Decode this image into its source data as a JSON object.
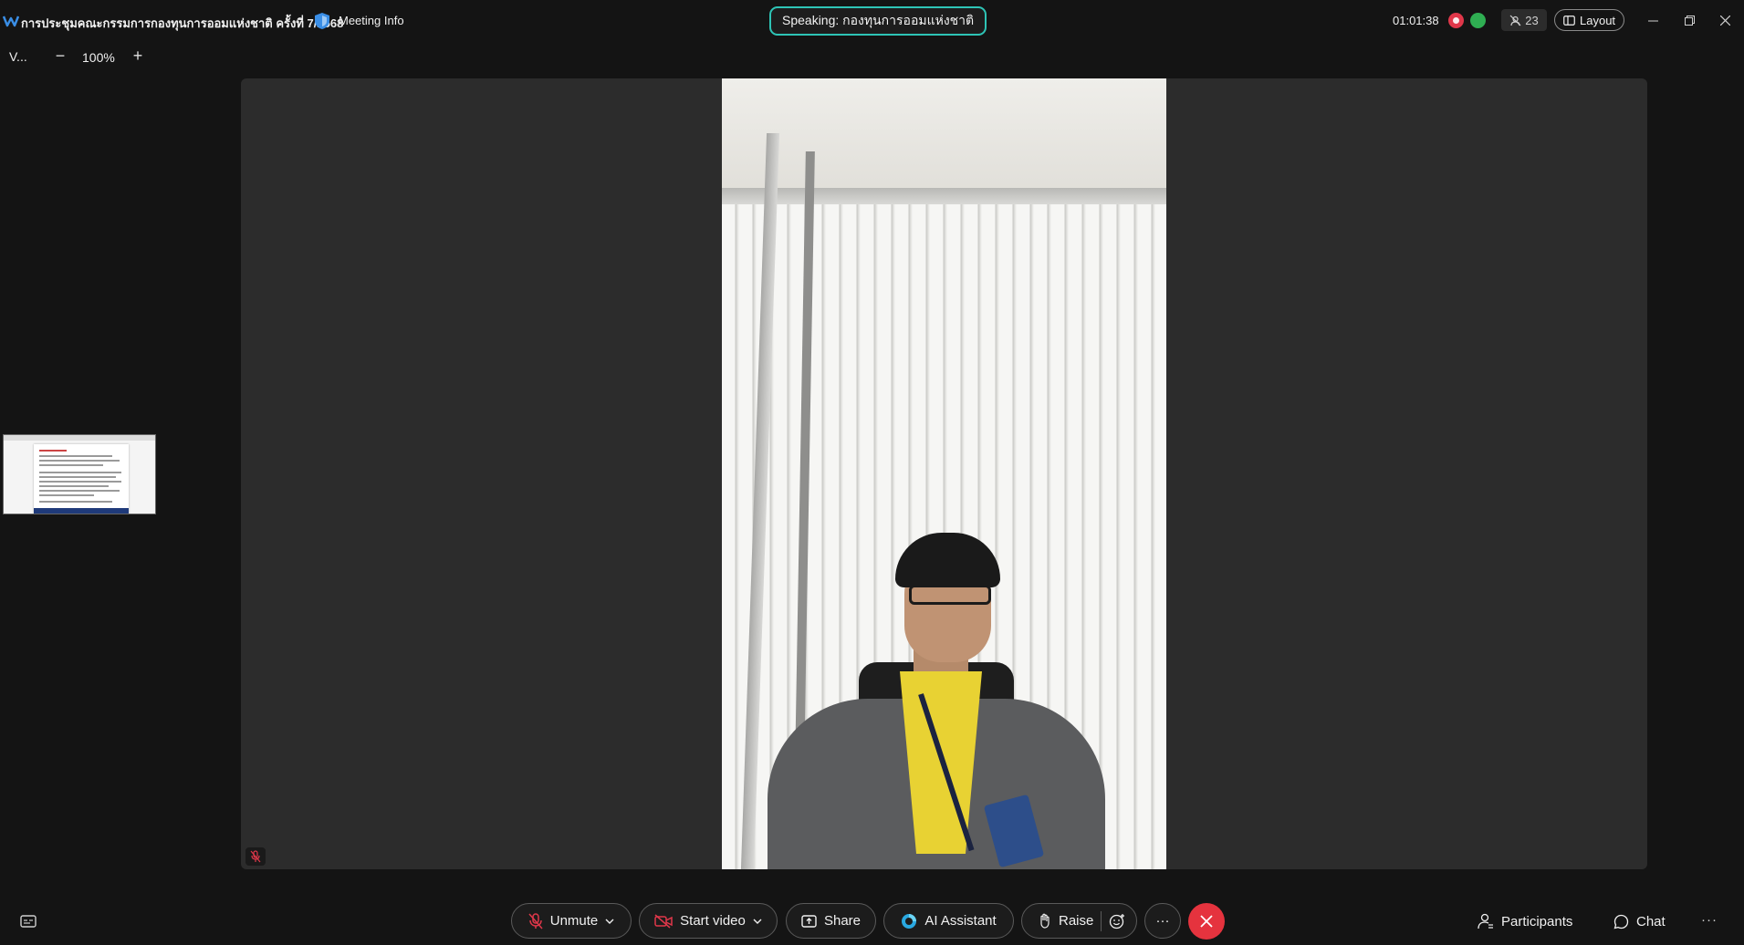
{
  "titlebar": {
    "meeting_title": "การประชุมคณะกรรมการกองทุนการออมแห่งชาติ ครั้งที่ 7/2568",
    "meeting_info": "Meeting Info",
    "speaking": "Speaking: กองทุนการออมแห่งชาติ",
    "timer": "01:01:38",
    "participant_count": "23",
    "layout_label": "Layout"
  },
  "view": {
    "label": "V...",
    "zoom": "100%",
    "minus": "−",
    "plus": "+"
  },
  "toolbar": {
    "unmute": "Unmute",
    "start_video": "Start video",
    "share": "Share",
    "ai_assistant": "AI Assistant",
    "raise": "Raise",
    "more": "···",
    "participants": "Participants",
    "chat": "Chat",
    "more_right": "···"
  },
  "colors": {
    "accent_teal": "#2ec4b6",
    "end_red": "#e5333e",
    "mute_red": "#e0374a",
    "network_green": "#2fae52"
  }
}
